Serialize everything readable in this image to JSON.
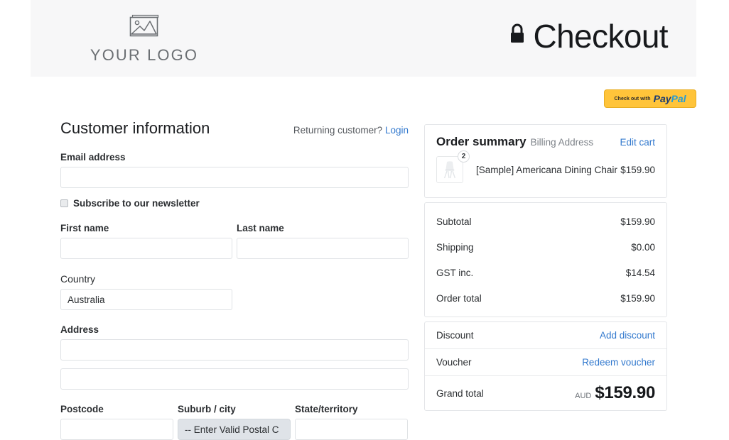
{
  "header": {
    "logo_icon": "image-placeholder-icon",
    "logo_text": "YOUR LOGO",
    "lock_icon": "lock-icon",
    "title": "Checkout",
    "background_color": "#f7f7f8"
  },
  "paypal": {
    "pre_text": "Check out with",
    "logo_pay": "Pay",
    "logo_pal": "Pal",
    "button_color": "#ffc43a"
  },
  "form": {
    "title": "Customer information",
    "returning_text": "Returning customer?",
    "login_label": "Login",
    "email_label": "Email address",
    "email_value": "",
    "email_placeholder": "",
    "subscribe_label": "Subscribe to our newsletter",
    "subscribe_checked": false,
    "first_name_label": "First name",
    "first_name_value": "",
    "last_name_label": "Last name",
    "last_name_value": "",
    "country_label": "Country",
    "country_value": "Australia",
    "address_label": "Address",
    "address_line1_value": "",
    "address_line2_value": "",
    "postcode_label": "Postcode",
    "postcode_value": "",
    "suburb_label": "Suburb / city",
    "suburb_value": "-- Enter Valid Postal C",
    "state_label": "State/territory",
    "state_value": ""
  },
  "summary": {
    "title": "Order summary",
    "subtitle": "Billing Address",
    "edit_cart_label": "Edit cart",
    "product": {
      "thumb_icon": "chair-product-icon",
      "quantity": "2",
      "name": "[Sample] Americana Dining Chair",
      "price": "$159.90"
    },
    "totals": [
      {
        "label": "Subtotal",
        "value": "$159.90"
      },
      {
        "label": "Shipping",
        "value": "$0.00"
      },
      {
        "label": "GST inc.",
        "value": "$14.54"
      },
      {
        "label": "Order total",
        "value": "$159.90"
      }
    ],
    "discount_label": "Discount",
    "discount_action": "Add discount",
    "voucher_label": "Voucher",
    "voucher_action": "Redeem voucher",
    "grand_total_label": "Grand total",
    "grand_total_currency": "AUD",
    "grand_total_value": "$159.90"
  },
  "colors": {
    "link": "#3279ce",
    "header_bg": "#f7f7f8",
    "border": "#e3e5e8"
  }
}
